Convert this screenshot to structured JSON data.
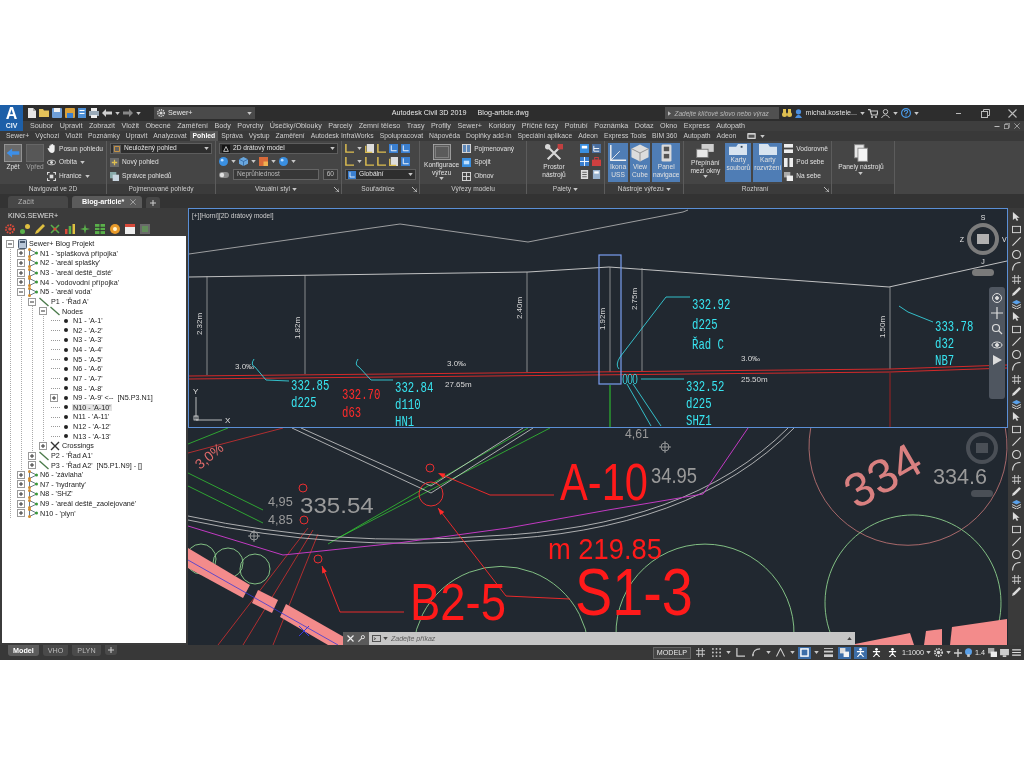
{
  "window": {
    "logo": "A",
    "logo_caption": "CIV",
    "workspace": "Sewer+",
    "title": "Autodesk Civil 3D 2019",
    "document": "Blog-article.dwg",
    "search": {
      "placeholder": "Zadejte klíčové slovo nebo výraz"
    },
    "user": "michal.kostele..."
  },
  "menu": [
    "Soubor",
    "Upravit",
    "Zobrazit",
    "Vložit",
    "Obecné",
    "Zaměření",
    "Body",
    "Povrchy",
    "Úsečky/Oblouky",
    "Parcely",
    "Zemní těleso",
    "Trasy",
    "Profily",
    "Sewer+",
    "Koridory",
    "Příčné řezy",
    "Potrubí",
    "Poznámka",
    "Dotaz",
    "Okno",
    "Express",
    "Autopath"
  ],
  "ribbon_tabs": [
    {
      "label": "Sewer+",
      "selected": false
    },
    {
      "label": "Výchozí",
      "selected": false
    },
    {
      "label": "Vložit",
      "selected": false
    },
    {
      "label": "Poznámky",
      "selected": false
    },
    {
      "label": "Upravit",
      "selected": false
    },
    {
      "label": "Analyzovat",
      "selected": false
    },
    {
      "label": "Pohled",
      "selected": true
    },
    {
      "label": "Správa",
      "selected": false
    },
    {
      "label": "Výstup",
      "selected": false
    },
    {
      "label": "Zaměření",
      "selected": false
    },
    {
      "label": "Autodesk InfraWorks",
      "selected": false
    },
    {
      "label": "Spolupracovat",
      "selected": false
    },
    {
      "label": "Nápověda",
      "selected": false
    },
    {
      "label": "Doplňky add-in",
      "selected": false
    },
    {
      "label": "Speciální aplikace",
      "selected": false
    },
    {
      "label": "Adeon",
      "selected": false
    },
    {
      "label": "Express Tools",
      "selected": false
    },
    {
      "label": "BIM 360",
      "selected": false
    },
    {
      "label": "Autopath",
      "selected": false
    },
    {
      "label": "Adeon",
      "selected": false
    }
  ],
  "ribbon_panels": [
    {
      "title": "Navigovat ve 2D",
      "columns": [
        [
          {
            "kind": "large",
            "label": "Zpět",
            "disabled": false
          }
        ],
        [
          {
            "kind": "large",
            "label": "Vpřed",
            "disabled": true
          }
        ],
        [
          {
            "kind": "small",
            "label": "Posun pohledu"
          },
          {
            "kind": "small",
            "label": "Orbita",
            "dropdown": true
          },
          {
            "kind": "small",
            "label": "Hranice",
            "dropdown": true
          }
        ]
      ]
    },
    {
      "title": "Pojmenované pohledy",
      "columns": [
        [
          {
            "kind": "combo",
            "value": "Neuložený pohled"
          },
          {
            "kind": "small",
            "label": "Nový pohled"
          },
          {
            "kind": "small",
            "label": "Správce pohledů"
          }
        ]
      ]
    },
    {
      "title": "Vizuální styl",
      "menu": true,
      "launcher": true,
      "columns": [
        [
          {
            "kind": "combo",
            "value": "2D drátový model"
          },
          {
            "kind": "iconrow"
          },
          {
            "kind": "field",
            "value": "Neprůhlednost",
            "reading": "60",
            "disabled": true
          }
        ]
      ]
    },
    {
      "title": "Souřadnice",
      "launcher": true,
      "columns": [
        [
          {
            "kind": "iconrow"
          },
          {
            "kind": "iconrow"
          },
          {
            "kind": "combo",
            "value": "Globální"
          }
        ]
      ]
    },
    {
      "title": "Výřezy modelu",
      "columns": [
        [
          {
            "kind": "large",
            "label": "Konfigurace výřezu",
            "dropdown": true
          }
        ],
        [
          {
            "kind": "small",
            "label": "Pojmenovaný"
          },
          {
            "kind": "small",
            "label": "Spojit"
          },
          {
            "kind": "small",
            "label": "Obnov"
          }
        ]
      ]
    },
    {
      "title": "Palety",
      "menu": true,
      "columns": [
        [
          {
            "kind": "large",
            "label": "Prostor nástrojů"
          }
        ],
        [
          {
            "kind": "iconrow"
          },
          {
            "kind": "iconrow"
          },
          {
            "kind": "iconrow"
          }
        ]
      ]
    },
    {
      "title": "Nástroje výřezu",
      "menu": true,
      "columns": [
        [
          {
            "kind": "large",
            "label": "Ikona USS",
            "on": true
          }
        ],
        [
          {
            "kind": "large",
            "label": "View Cube",
            "on": true
          }
        ],
        [
          {
            "kind": "large",
            "label": "Panel navigace",
            "on": true
          }
        ]
      ]
    },
    {
      "title": "Rozhraní",
      "launcher": true,
      "columns": [
        [
          {
            "kind": "large",
            "label": "Přepínání mezi okny",
            "dropdown": true,
            "on": false
          }
        ],
        [
          {
            "kind": "large",
            "label": "Karty souborů",
            "on": true
          }
        ],
        [
          {
            "kind": "large",
            "label": "Karty rozvržení",
            "on": true
          }
        ],
        [
          {
            "kind": "small",
            "label": "Vodorovně"
          },
          {
            "kind": "small",
            "label": "Pod sebe"
          },
          {
            "kind": "small",
            "label": "Na sebe"
          }
        ]
      ]
    },
    {
      "columns": [
        [
          {
            "kind": "large",
            "label": "Panely nástrojů",
            "dropdown": true
          }
        ]
      ]
    }
  ],
  "file_tabs": [
    {
      "label": "Začít",
      "selected": false
    },
    {
      "label": "Blog-article*",
      "selected": true
    }
  ],
  "tool_palette": {
    "title": "KING.SEWER+",
    "tree": [
      {
        "label": "Sewer+ Blog Projekt",
        "kind": "project",
        "expanded": true,
        "selected": false,
        "children": [
          {
            "label": "N1 - 'splašková přípojka'",
            "kind": "network",
            "expanded": false,
            "selected": false
          },
          {
            "label": "N2 - 'areál splašky'",
            "kind": "network",
            "expanded": false,
            "selected": false
          },
          {
            "label": "N3 - 'areál deště_čisté'",
            "kind": "network",
            "expanded": false,
            "selected": false
          },
          {
            "label": "N4 - 'vodovodní přípojka'",
            "kind": "network",
            "expanded": false,
            "selected": false
          },
          {
            "label": "N5 - 'areál voda'",
            "kind": "network",
            "expanded": true,
            "selected": false,
            "children": [
              {
                "label": "P1 - 'Řad A'",
                "kind": "pipe",
                "expanded": true,
                "selected": false,
                "children": [
                  {
                    "label": "Nodes",
                    "kind": "pipe",
                    "expanded": true,
                    "selected": false,
                    "children": [
                      {
                        "label": "N1 - 'A-1'",
                        "kind": "node",
                        "selected": false
                      },
                      {
                        "label": "N2 - 'A-2'",
                        "kind": "node",
                        "selected": false
                      },
                      {
                        "label": "N3 - 'A-3'",
                        "kind": "node",
                        "selected": false
                      },
                      {
                        "label": "N4 - 'A-4'",
                        "kind": "node",
                        "selected": false
                      },
                      {
                        "label": "N5 - 'A-5'",
                        "kind": "node",
                        "selected": false
                      },
                      {
                        "label": "N6 - 'A-6'",
                        "kind": "node",
                        "selected": false
                      },
                      {
                        "label": "N7 - 'A-7'",
                        "kind": "node",
                        "selected": false
                      },
                      {
                        "label": "N8 - 'A-8'",
                        "kind": "node",
                        "selected": false
                      },
                      {
                        "label": "N9 - 'A-9' <--  [N5.P3.N1]",
                        "kind": "node",
                        "expanded": false,
                        "selected": false
                      },
                      {
                        "label": "N10 - 'A-10'",
                        "kind": "node",
                        "selected": true
                      },
                      {
                        "label": "N11 - 'A-11'",
                        "kind": "node",
                        "selected": false
                      },
                      {
                        "label": "N12 - 'A-12'",
                        "kind": "node",
                        "selected": false
                      },
                      {
                        "label": "N13 - 'A-13'",
                        "kind": "node",
                        "selected": false
                      }
                    ]
                  },
                  {
                    "label": "Crossings",
                    "kind": "crossings",
                    "expanded": false,
                    "selected": false
                  }
                ]
              },
              {
                "label": "P2 - 'Řad A1'",
                "kind": "pipe",
                "expanded": false,
                "selected": false
              },
              {
                "label": "P3 - 'Řad A2'  [N5.P1.N9] - []",
                "kind": "pipe",
                "expanded": false,
                "selected": false
              }
            ]
          },
          {
            "label": "N6 - 'závlaha'",
            "kind": "network",
            "expanded": false,
            "selected": false
          },
          {
            "label": "N7 - 'hydranty'",
            "kind": "network",
            "expanded": false,
            "selected": false
          },
          {
            "label": "N8 - 'SHZ'",
            "kind": "network",
            "expanded": false,
            "selected": false
          },
          {
            "label": "N9 - 'areál deště_zaolejované'",
            "kind": "network",
            "expanded": false,
            "selected": false
          },
          {
            "label": "N10 - 'plyn'",
            "kind": "network",
            "expanded": false,
            "selected": false
          }
        ]
      }
    ]
  },
  "drawing": {
    "profile_view": {
      "caption": "[+][Horní][2D drátový model]",
      "compass": [
        "S",
        "V",
        "J",
        "Z"
      ],
      "ucs": [
        "X",
        "Y"
      ],
      "heights": [
        "2.32m",
        "1.82m",
        "2.40m",
        "1.92m",
        "2.75m",
        "1.50m"
      ],
      "slopes": [
        {
          "grade": "3.0‰"
        },
        {
          "grade": "3.0‰",
          "length": "27.65m"
        },
        {
          "grade": "3.0‰",
          "length": "25.50m"
        }
      ],
      "labels": [
        {
          "color": "#38e4f0",
          "lines": [
            "332.85",
            "d225"
          ]
        },
        {
          "color": "#ff2b2b",
          "lines": [
            "332.70",
            "d63"
          ]
        },
        {
          "color": "#38e4f0",
          "lines": [
            "332.84",
            "d110",
            "HN1"
          ]
        },
        {
          "color": "#38e4f0",
          "lines": [
            "332.92",
            "d225",
            "Řad C"
          ]
        },
        {
          "color": "#38e4f0",
          "lines": [
            "332.52",
            "d225",
            "SHZ1"
          ]
        },
        {
          "color": "#38e4f0",
          "lines": [
            "333.78",
            "d32",
            "NB7"
          ]
        }
      ]
    },
    "plan_view": {
      "labels": [
        {
          "text": "3,0%",
          "color": "#e06a6a"
        },
        {
          "text": "4,61",
          "color": "#9a9a9a"
        },
        {
          "text": "334",
          "color": "#d98080"
        },
        {
          "text": "A-10",
          "color": "#ff1a1a"
        },
        {
          "text": "34.95",
          "color": "#9a9a9a"
        },
        {
          "text": "334.6",
          "color": "#9a9a9a"
        },
        {
          "text": "4,95",
          "color": "#9a9a9a"
        },
        {
          "text": "335.54",
          "color": "#9a9a9a"
        },
        {
          "text": "4,85",
          "color": "#9a9a9a"
        },
        {
          "text": "m 219.85",
          "color": "#ff1a1a"
        },
        {
          "text": "B2-5",
          "color": "#ff1a1a"
        },
        {
          "text": "S1-3",
          "color": "#ff1a1a"
        }
      ]
    },
    "command_line": {
      "placeholder": "Zadejte příkaz"
    }
  },
  "layout_tabs": [
    {
      "label": "Model",
      "selected": true
    },
    {
      "label": "VHO",
      "selected": false
    },
    {
      "label": "PLYN",
      "selected": false
    }
  ],
  "status_bar": {
    "space": "MODELP",
    "toggles": [
      {
        "kind": "grid",
        "on": false
      },
      {
        "kind": "snap",
        "on": false
      },
      {
        "kind": "ortho",
        "on": false
      },
      {
        "kind": "polar",
        "on": false
      },
      {
        "kind": "isodraft",
        "on": false
      },
      {
        "kind": "osnap",
        "on": true
      },
      {
        "kind": "lineweight",
        "on": false
      },
      {
        "kind": "transparency",
        "on": true
      },
      {
        "kind": "dynucs",
        "on": true
      },
      {
        "kind": "annovis",
        "on": false
      },
      {
        "kind": "autoscale",
        "on": false
      }
    ],
    "scale": "1:1000",
    "annotation_scale": "1.4"
  }
}
